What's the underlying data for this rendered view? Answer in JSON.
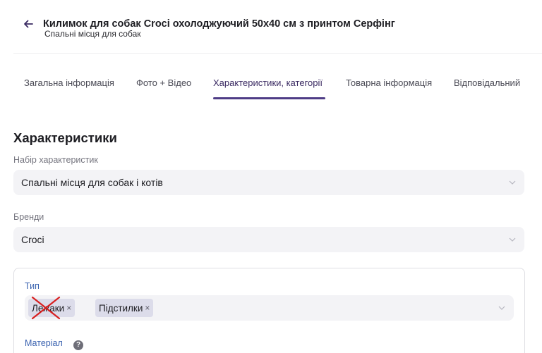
{
  "header": {
    "title": "Килимок для собак Croci охолоджуючий 50х40 см з принтом Серфінг",
    "subtitle": "Спальні місця для собак"
  },
  "tabs": [
    {
      "label": "Загальна інформація",
      "active": false
    },
    {
      "label": "Фото + Відео",
      "active": false
    },
    {
      "label": "Характеристики, категорії",
      "active": true
    },
    {
      "label": "Товарна інформація",
      "active": false
    },
    {
      "label": "Відповідальний",
      "active": false
    }
  ],
  "section": {
    "title": "Характеристики"
  },
  "characteristics_set": {
    "label": "Набір характеристик",
    "value": "Спальні місця для собак і котів"
  },
  "brands": {
    "label": "Бренди",
    "value": "Croci"
  },
  "type": {
    "label": "Тип",
    "chips": [
      "Лежаки",
      "Підстилки"
    ]
  },
  "material": {
    "label": "Матеріал"
  },
  "colors": {
    "accent": "#4e3c86",
    "label_blue": "#3b63b0",
    "cross_red": "#d82020"
  }
}
